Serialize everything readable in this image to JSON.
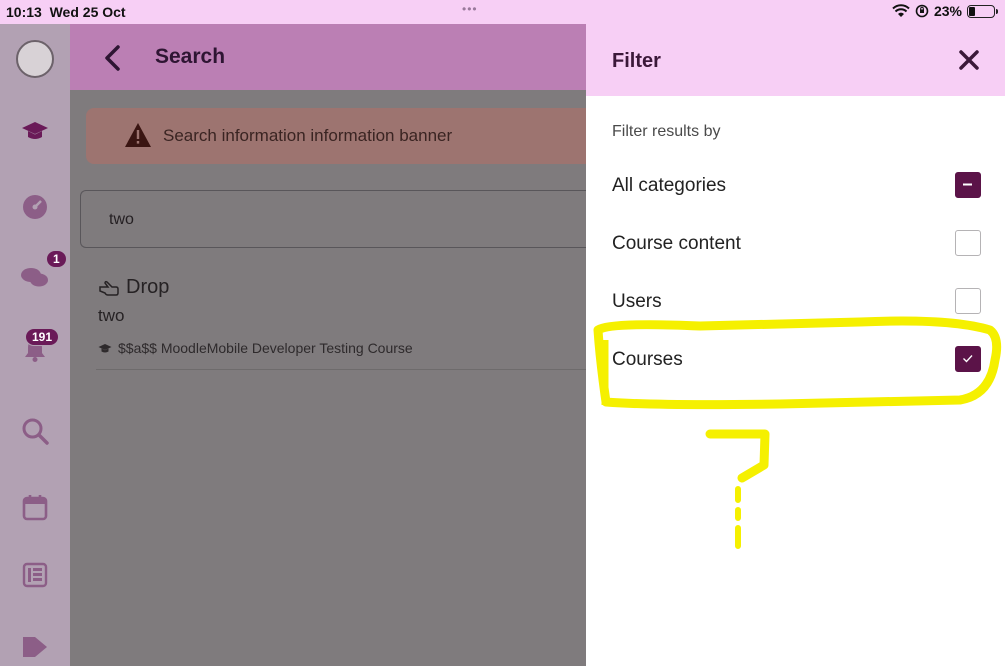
{
  "status_bar": {
    "time": "10:13",
    "date": "Wed 25 Oct",
    "dots": "•••",
    "battery": "23%",
    "icons": [
      "wifi-icon",
      "orientation-lock-icon",
      "battery-icon"
    ]
  },
  "rail": {
    "items": [
      {
        "name": "avatar",
        "icon": "user-avatar"
      },
      {
        "name": "courses",
        "icon": "graduation-cap-icon"
      },
      {
        "name": "dashboard",
        "icon": "dashboard-gauge-icon"
      },
      {
        "name": "messages",
        "icon": "chat-bubbles-icon",
        "badge": "1"
      },
      {
        "name": "notifications",
        "icon": "bell-icon",
        "badge": "191"
      },
      {
        "name": "search",
        "icon": "search-icon"
      },
      {
        "name": "calendar",
        "icon": "calendar-icon"
      },
      {
        "name": "grades",
        "icon": "gradebook-icon"
      },
      {
        "name": "tags",
        "icon": "tag-icon"
      }
    ]
  },
  "main": {
    "title": "Search",
    "banner": "Search information information banner",
    "search_value": "two",
    "result": {
      "title": "Drop",
      "subtitle": "two",
      "course": "$$a$$ MoodleMobile Developer Testing Course"
    }
  },
  "filter": {
    "title": "Filter",
    "heading": "Filter results by",
    "options": [
      {
        "label": "All categories",
        "state": "indeterminate"
      },
      {
        "label": "Course content",
        "state": "unchecked"
      },
      {
        "label": "Users",
        "state": "unchecked"
      },
      {
        "label": "Courses",
        "state": "checked"
      }
    ]
  },
  "colors": {
    "accent": "#5b1348",
    "header_pink": "#f7cff5",
    "annotation_yellow": "#f5f000"
  }
}
